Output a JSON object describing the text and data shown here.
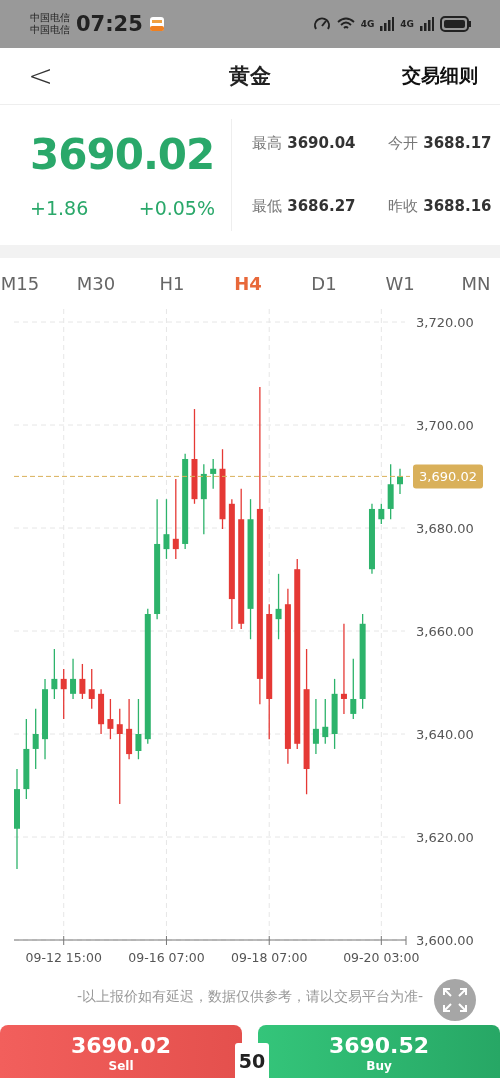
{
  "status_bar": {
    "carriers": [
      "中国电信",
      "中国电信"
    ],
    "time": "07:25",
    "network": [
      "4G",
      "4G"
    ]
  },
  "header": {
    "back": "<",
    "title": "黄金",
    "action": "交易细则"
  },
  "quote": {
    "price": "3690.02",
    "change": "+1.86",
    "change_pct": "+0.05%",
    "stats": [
      {
        "label": "最高",
        "value": "3690.04"
      },
      {
        "label": "今开",
        "value": "3688.17"
      },
      {
        "label": "最低",
        "value": "3686.27"
      },
      {
        "label": "昨收",
        "value": "3688.16"
      }
    ]
  },
  "tabs": [
    {
      "label": "M15",
      "selected": false
    },
    {
      "label": "M30",
      "selected": false
    },
    {
      "label": "H1",
      "selected": false
    },
    {
      "label": "H4",
      "selected": true
    },
    {
      "label": "D1",
      "selected": false
    },
    {
      "label": "W1",
      "selected": false
    },
    {
      "label": "MN",
      "selected": false
    }
  ],
  "chart_data": {
    "type": "candlestick",
    "ylim": [
      3600,
      3720
    ],
    "yticks": [
      {
        "value": 3720,
        "label": "3,720.00"
      },
      {
        "value": 3700,
        "label": "3,700.00"
      },
      {
        "value": 3680,
        "label": "3,680.00"
      },
      {
        "value": 3660,
        "label": "3,660.00"
      },
      {
        "value": 3640,
        "label": "3,640.00"
      },
      {
        "value": 3620,
        "label": "3,620.00"
      },
      {
        "value": 3600,
        "label": "3,600.00"
      }
    ],
    "categories": [
      null,
      null,
      null,
      null,
      null,
      "09-12 15:00",
      null,
      null,
      null,
      null,
      null,
      null,
      null,
      null,
      null,
      null,
      "09-16 07:00",
      null,
      null,
      null,
      null,
      null,
      null,
      null,
      null,
      null,
      null,
      "09-18 07:00",
      null,
      null,
      null,
      null,
      null,
      null,
      null,
      null,
      null,
      null,
      null,
      "09-20 03:00",
      null,
      null
    ],
    "ohlc": [
      [
        3621.6,
        3633.2,
        3613.8,
        3629.3
      ],
      [
        3629.3,
        3642.9,
        3627.4,
        3637.1
      ],
      [
        3637.1,
        3644.9,
        3633.2,
        3640.0
      ],
      [
        3639.0,
        3650.7,
        3635.1,
        3648.7
      ],
      [
        3648.7,
        3656.5,
        3646.8,
        3650.7
      ],
      [
        3650.7,
        3652.6,
        3642.9,
        3648.7
      ],
      [
        3647.8,
        3654.6,
        3646.8,
        3650.7
      ],
      [
        3650.7,
        3653.6,
        3646.8,
        3647.8
      ],
      [
        3648.7,
        3652.6,
        3644.9,
        3646.8
      ],
      [
        3647.8,
        3648.7,
        3640.0,
        3641.9
      ],
      [
        3642.9,
        3646.8,
        3639.0,
        3641.0
      ],
      [
        3641.9,
        3644.9,
        3626.4,
        3640.0
      ],
      [
        3641.0,
        3646.8,
        3635.1,
        3636.1
      ],
      [
        3636.7,
        3646.8,
        3635.1,
        3640.0
      ],
      [
        3639.0,
        3664.3,
        3638.1,
        3663.3
      ],
      [
        3663.3,
        3685.6,
        3662.3,
        3676.9
      ],
      [
        3675.9,
        3685.6,
        3674.0,
        3678.8
      ],
      [
        3677.9,
        3689.5,
        3674.0,
        3675.9
      ],
      [
        3676.9,
        3694.4,
        3675.9,
        3693.4
      ],
      [
        3693.4,
        3703.1,
        3684.7,
        3685.6
      ],
      [
        3685.6,
        3692.4,
        3678.8,
        3690.5
      ],
      [
        3690.5,
        3693.4,
        3687.6,
        3691.5
      ],
      [
        3691.5,
        3695.3,
        3679.8,
        3681.7
      ],
      [
        3684.7,
        3685.6,
        3660.4,
        3666.2
      ],
      [
        3681.7,
        3687.6,
        3660.4,
        3661.4
      ],
      [
        3664.3,
        3685.6,
        3658.4,
        3681.7
      ],
      [
        3683.7,
        3707.4,
        3645.8,
        3650.7
      ],
      [
        3663.3,
        3665.2,
        3639.0,
        3646.8
      ],
      [
        3662.3,
        3671.1,
        3658.4,
        3664.3
      ],
      [
        3665.2,
        3668.2,
        3634.2,
        3637.1
      ],
      [
        3672.0,
        3674.0,
        3637.1,
        3638.1
      ],
      [
        3648.7,
        3656.5,
        3628.3,
        3633.2
      ],
      [
        3638.1,
        3646.8,
        3636.1,
        3641.0
      ],
      [
        3639.4,
        3646.8,
        3638.1,
        3641.4
      ],
      [
        3640.0,
        3650.7,
        3637.1,
        3647.8
      ],
      [
        3647.8,
        3661.4,
        3643.9,
        3646.8
      ],
      [
        3643.9,
        3654.6,
        3642.9,
        3646.8
      ],
      [
        3646.8,
        3663.3,
        3644.9,
        3661.4
      ],
      [
        3672.0,
        3684.7,
        3671.1,
        3683.7
      ],
      [
        3681.7,
        3684.7,
        3680.8,
        3683.7
      ],
      [
        3683.7,
        3692.4,
        3681.7,
        3688.5
      ],
      [
        3688.5,
        3691.5,
        3686.6,
        3690.02
      ]
    ],
    "grid": true,
    "ref_lines": [
      {
        "axis": "y",
        "value": 3690.02,
        "label": "3,690.02"
      }
    ]
  },
  "disclaimer": "-以上报价如有延迟，数据仅供参考，请以交易平台为准-",
  "trade": {
    "sell": {
      "price": "3690.02",
      "label": "Sell"
    },
    "spread": "50",
    "buy": {
      "price": "3690.52",
      "label": "Buy"
    }
  }
}
